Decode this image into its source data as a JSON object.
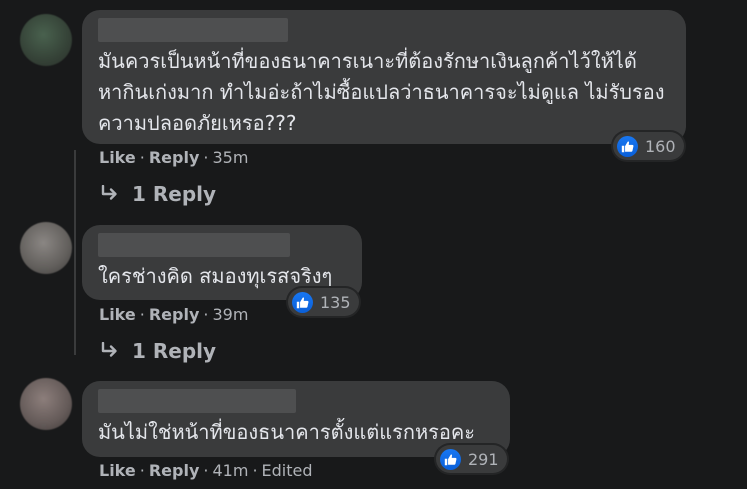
{
  "comments": [
    {
      "text": "มันควรเป็นหน้าที่ของธนาคารเนาะที่ต้องรักษาเงินลูกค้าไว้ให้ได้ หากินเก่งมาก ทำไมอ่ะถ้าไม่ซื้อแปลว่าธนาคารจะไม่ดูแล ไม่รับรองความปลอดภัยเหรอ???",
      "reactions": "160",
      "like": "Like",
      "reply": "Reply",
      "time": "35m",
      "replies_label": "1 Reply"
    },
    {
      "text": "ใครช่างคิด สมองทุเรสจริงๆ",
      "reactions": "135",
      "like": "Like",
      "reply": "Reply",
      "time": "39m",
      "replies_label": "1 Reply"
    },
    {
      "text": "มันไม่ใช่หน้าที่ของธนาคารตั้งแต่แรกหรอคะ",
      "reactions": "291",
      "like": "Like",
      "reply": "Reply",
      "time": "41m",
      "edited": "Edited"
    }
  ],
  "separator": "·",
  "icons": {
    "reaction": "like-thumbs-up-icon",
    "replies": "reply-arrow-icon"
  },
  "colors": {
    "background": "#18191a",
    "bubble": "#3a3b3c",
    "like_blue": "#1877f2",
    "muted_text": "#b0b3b8",
    "text": "#e4e6eb"
  }
}
